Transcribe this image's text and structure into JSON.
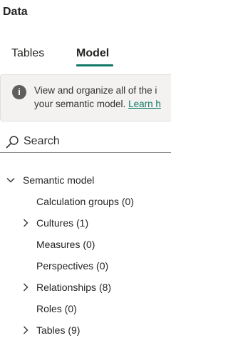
{
  "pane": {
    "title": "Data"
  },
  "tabs": [
    {
      "label": "Tables",
      "selected": false
    },
    {
      "label": "Model",
      "selected": true
    }
  ],
  "info": {
    "line1": "View and organize all of the i",
    "line2": "your semantic model. ",
    "link": "Learn h"
  },
  "search": {
    "placeholder": "Search",
    "value": ""
  },
  "tree": {
    "root": {
      "label": "Semantic model",
      "icon": "chevron-down-icon"
    },
    "items": [
      {
        "label": "Calculation groups (0)",
        "expandable": false
      },
      {
        "label": "Cultures (1)",
        "expandable": true,
        "icon": "chevron-right-icon"
      },
      {
        "label": "Measures (0)",
        "expandable": false
      },
      {
        "label": "Perspectives (0)",
        "expandable": false
      },
      {
        "label": "Relationships (8)",
        "expandable": true,
        "icon": "chevron-right-icon"
      },
      {
        "label": "Roles (0)",
        "expandable": false
      },
      {
        "label": "Tables (9)",
        "expandable": true,
        "icon": "chevron-right-icon"
      }
    ]
  },
  "colors": {
    "accent": "#117865",
    "info_background": "#f3f2f1",
    "text": "#252423"
  }
}
